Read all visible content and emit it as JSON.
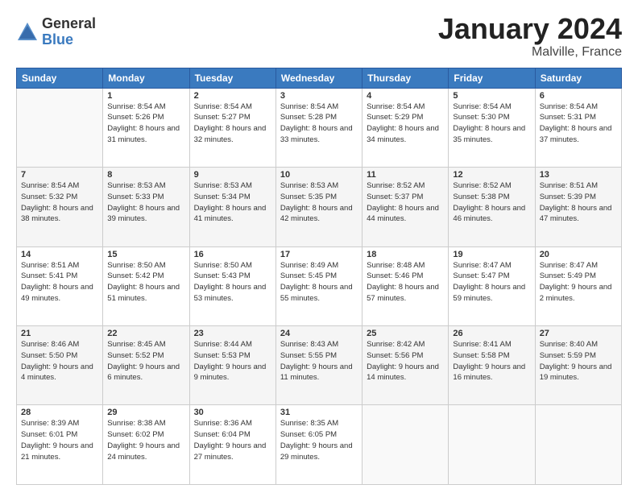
{
  "logo": {
    "general": "General",
    "blue": "Blue"
  },
  "title": "January 2024",
  "location": "Malville, France",
  "weekdays": [
    "Sunday",
    "Monday",
    "Tuesday",
    "Wednesday",
    "Thursday",
    "Friday",
    "Saturday"
  ],
  "weeks": [
    [
      {
        "day": "",
        "sunrise": "",
        "sunset": "",
        "daylight": ""
      },
      {
        "day": "1",
        "sunrise": "Sunrise: 8:54 AM",
        "sunset": "Sunset: 5:26 PM",
        "daylight": "Daylight: 8 hours and 31 minutes."
      },
      {
        "day": "2",
        "sunrise": "Sunrise: 8:54 AM",
        "sunset": "Sunset: 5:27 PM",
        "daylight": "Daylight: 8 hours and 32 minutes."
      },
      {
        "day": "3",
        "sunrise": "Sunrise: 8:54 AM",
        "sunset": "Sunset: 5:28 PM",
        "daylight": "Daylight: 8 hours and 33 minutes."
      },
      {
        "day": "4",
        "sunrise": "Sunrise: 8:54 AM",
        "sunset": "Sunset: 5:29 PM",
        "daylight": "Daylight: 8 hours and 34 minutes."
      },
      {
        "day": "5",
        "sunrise": "Sunrise: 8:54 AM",
        "sunset": "Sunset: 5:30 PM",
        "daylight": "Daylight: 8 hours and 35 minutes."
      },
      {
        "day": "6",
        "sunrise": "Sunrise: 8:54 AM",
        "sunset": "Sunset: 5:31 PM",
        "daylight": "Daylight: 8 hours and 37 minutes."
      }
    ],
    [
      {
        "day": "7",
        "sunrise": "Sunrise: 8:54 AM",
        "sunset": "Sunset: 5:32 PM",
        "daylight": "Daylight: 8 hours and 38 minutes."
      },
      {
        "day": "8",
        "sunrise": "Sunrise: 8:53 AM",
        "sunset": "Sunset: 5:33 PM",
        "daylight": "Daylight: 8 hours and 39 minutes."
      },
      {
        "day": "9",
        "sunrise": "Sunrise: 8:53 AM",
        "sunset": "Sunset: 5:34 PM",
        "daylight": "Daylight: 8 hours and 41 minutes."
      },
      {
        "day": "10",
        "sunrise": "Sunrise: 8:53 AM",
        "sunset": "Sunset: 5:35 PM",
        "daylight": "Daylight: 8 hours and 42 minutes."
      },
      {
        "day": "11",
        "sunrise": "Sunrise: 8:52 AM",
        "sunset": "Sunset: 5:37 PM",
        "daylight": "Daylight: 8 hours and 44 minutes."
      },
      {
        "day": "12",
        "sunrise": "Sunrise: 8:52 AM",
        "sunset": "Sunset: 5:38 PM",
        "daylight": "Daylight: 8 hours and 46 minutes."
      },
      {
        "day": "13",
        "sunrise": "Sunrise: 8:51 AM",
        "sunset": "Sunset: 5:39 PM",
        "daylight": "Daylight: 8 hours and 47 minutes."
      }
    ],
    [
      {
        "day": "14",
        "sunrise": "Sunrise: 8:51 AM",
        "sunset": "Sunset: 5:41 PM",
        "daylight": "Daylight: 8 hours and 49 minutes."
      },
      {
        "day": "15",
        "sunrise": "Sunrise: 8:50 AM",
        "sunset": "Sunset: 5:42 PM",
        "daylight": "Daylight: 8 hours and 51 minutes."
      },
      {
        "day": "16",
        "sunrise": "Sunrise: 8:50 AM",
        "sunset": "Sunset: 5:43 PM",
        "daylight": "Daylight: 8 hours and 53 minutes."
      },
      {
        "day": "17",
        "sunrise": "Sunrise: 8:49 AM",
        "sunset": "Sunset: 5:45 PM",
        "daylight": "Daylight: 8 hours and 55 minutes."
      },
      {
        "day": "18",
        "sunrise": "Sunrise: 8:48 AM",
        "sunset": "Sunset: 5:46 PM",
        "daylight": "Daylight: 8 hours and 57 minutes."
      },
      {
        "day": "19",
        "sunrise": "Sunrise: 8:47 AM",
        "sunset": "Sunset: 5:47 PM",
        "daylight": "Daylight: 8 hours and 59 minutes."
      },
      {
        "day": "20",
        "sunrise": "Sunrise: 8:47 AM",
        "sunset": "Sunset: 5:49 PM",
        "daylight": "Daylight: 9 hours and 2 minutes."
      }
    ],
    [
      {
        "day": "21",
        "sunrise": "Sunrise: 8:46 AM",
        "sunset": "Sunset: 5:50 PM",
        "daylight": "Daylight: 9 hours and 4 minutes."
      },
      {
        "day": "22",
        "sunrise": "Sunrise: 8:45 AM",
        "sunset": "Sunset: 5:52 PM",
        "daylight": "Daylight: 9 hours and 6 minutes."
      },
      {
        "day": "23",
        "sunrise": "Sunrise: 8:44 AM",
        "sunset": "Sunset: 5:53 PM",
        "daylight": "Daylight: 9 hours and 9 minutes."
      },
      {
        "day": "24",
        "sunrise": "Sunrise: 8:43 AM",
        "sunset": "Sunset: 5:55 PM",
        "daylight": "Daylight: 9 hours and 11 minutes."
      },
      {
        "day": "25",
        "sunrise": "Sunrise: 8:42 AM",
        "sunset": "Sunset: 5:56 PM",
        "daylight": "Daylight: 9 hours and 14 minutes."
      },
      {
        "day": "26",
        "sunrise": "Sunrise: 8:41 AM",
        "sunset": "Sunset: 5:58 PM",
        "daylight": "Daylight: 9 hours and 16 minutes."
      },
      {
        "day": "27",
        "sunrise": "Sunrise: 8:40 AM",
        "sunset": "Sunset: 5:59 PM",
        "daylight": "Daylight: 9 hours and 19 minutes."
      }
    ],
    [
      {
        "day": "28",
        "sunrise": "Sunrise: 8:39 AM",
        "sunset": "Sunset: 6:01 PM",
        "daylight": "Daylight: 9 hours and 21 minutes."
      },
      {
        "day": "29",
        "sunrise": "Sunrise: 8:38 AM",
        "sunset": "Sunset: 6:02 PM",
        "daylight": "Daylight: 9 hours and 24 minutes."
      },
      {
        "day": "30",
        "sunrise": "Sunrise: 8:36 AM",
        "sunset": "Sunset: 6:04 PM",
        "daylight": "Daylight: 9 hours and 27 minutes."
      },
      {
        "day": "31",
        "sunrise": "Sunrise: 8:35 AM",
        "sunset": "Sunset: 6:05 PM",
        "daylight": "Daylight: 9 hours and 29 minutes."
      },
      {
        "day": "",
        "sunrise": "",
        "sunset": "",
        "daylight": ""
      },
      {
        "day": "",
        "sunrise": "",
        "sunset": "",
        "daylight": ""
      },
      {
        "day": "",
        "sunrise": "",
        "sunset": "",
        "daylight": ""
      }
    ]
  ]
}
